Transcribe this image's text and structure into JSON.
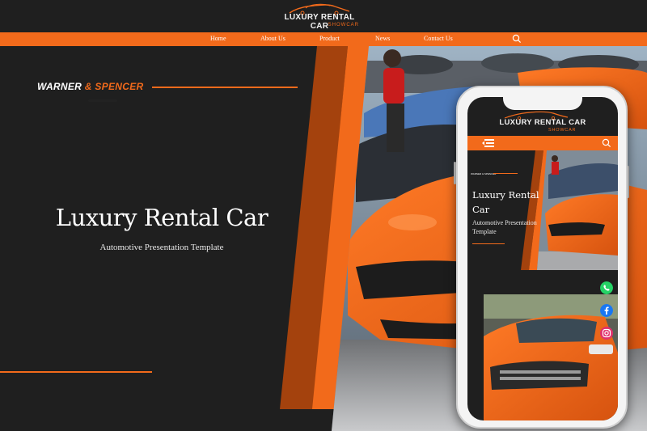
{
  "header": {
    "logo_title": "LUXURY RENTAL CAR",
    "logo_subtitle": "SHOWCAR"
  },
  "nav": {
    "items": [
      {
        "label": "Home"
      },
      {
        "label": "About Us"
      },
      {
        "label": "Product"
      },
      {
        "label": "News"
      },
      {
        "label": "Contact Us"
      }
    ],
    "search_icon": "search-icon"
  },
  "hero": {
    "brand_part1": "WARNER ",
    "brand_part2": "& SPENCER",
    "title": "Luxury Rental Car",
    "subtitle": "Automotive Presentation Template"
  },
  "phone": {
    "logo_title": "LUXURY RENTAL CAR",
    "logo_subtitle": "SHOWCAR",
    "menu_icon": "menu-icon",
    "search_icon": "search-icon",
    "brand": "WARNER & SPENCER",
    "title": "Luxury Rental Car",
    "subtitle": "Automotive Presentation Template"
  },
  "social": [
    "whatsapp-icon",
    "facebook-icon",
    "instagram-icon"
  ],
  "colors": {
    "accent": "#f26a1b",
    "background": "#1f1f1f",
    "text": "#ffffff",
    "whatsapp": "#25d366",
    "facebook": "#1877f2",
    "instagram": "#e1306c"
  }
}
